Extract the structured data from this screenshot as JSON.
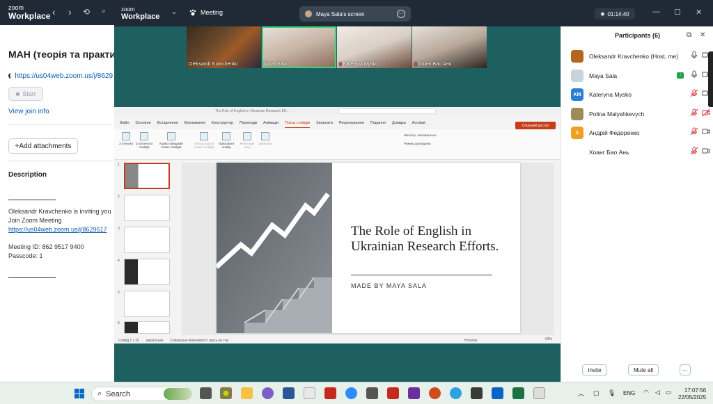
{
  "bg_window": {
    "logo_line1": "zoom",
    "logo_line2": "Workplace",
    "meeting_title": "МАН (теорія та практик",
    "meeting_link": "https://us04web.zoom.us/j/8629",
    "start_label": "Start",
    "view_join_info": "View join info",
    "add_attachments": "+Add attachments",
    "description_title": "Description",
    "description_lines": [
      "Oleksandr Kravchenko is inviting you",
      "Join Zoom Meeting"
    ],
    "description_link": "https://us04web.zoom.us/j/8629517",
    "meeting_id": "Meeting ID: 862 9517 9400",
    "passcode": "Passcode: 1"
  },
  "meeting": {
    "logo_line1": "zoom",
    "logo_line2": "Workplace",
    "meeting_tab": "Meeting",
    "share_label": "Maya Sala's screen",
    "timer": "01:14:40"
  },
  "thumbnails": [
    {
      "name": "Oleksandr Kravchenko"
    },
    {
      "name": "Maya Sala"
    },
    {
      "name": "Kateryna Mysko"
    },
    {
      "name": "Хоанг Бао Ань"
    }
  ],
  "ppt": {
    "doc_title": "The Role of English in Ukrainian Research Eff...",
    "tabs": [
      "Файл",
      "Основне",
      "Вставлення",
      "Малювання",
      "Конструктор",
      "Переходи",
      "Анімація",
      "Показ слайдів",
      "Записати",
      "Рецензування",
      "Подання",
      "Довідка",
      "Acrobat"
    ],
    "active_tab": "Показ слайдів",
    "share_button": "Спільний доступ",
    "ribbon": [
      "З початку",
      "З поточного слайда",
      "Користувацький показ слайдів",
      "Налаштувати показ слайдів",
      "Приховати слайд",
      "Репетиція часу",
      "Записати",
      "Монітор: Автоматично",
      "Режим доповідача"
    ],
    "slide_numbers": [
      "1",
      "2",
      "3",
      "4",
      "5",
      "6"
    ],
    "slide_title": "The Role of English in Ukrainian Research Efforts.",
    "slide_subtitle": "MADE BY MAYA SALA",
    "status_slide": "Слайд 1 з 10",
    "status_lang": "українська",
    "status_access": "Спеціальні можливості: щось не так",
    "status_notes": "Нотатки",
    "zoom_level": "63%"
  },
  "participants": {
    "title": "Participants (6)",
    "list": [
      {
        "name": "Oleksandr Kravchenko (Host, me)",
        "initials": "",
        "color": "#b5651d",
        "sharing": false,
        "mic_muted": false,
        "cam_off": false
      },
      {
        "name": "Maya Sala",
        "initials": "",
        "color": "#c9d3dc",
        "sharing": true,
        "mic_muted": false,
        "cam_off": false
      },
      {
        "name": "Kateryna Mysko",
        "initials": "KM",
        "color": "#2d7dd2",
        "sharing": false,
        "mic_muted": true,
        "cam_off": false
      },
      {
        "name": "Polina Malyshkevych",
        "initials": "",
        "color": "#a08a5a",
        "sharing": false,
        "mic_muted": true,
        "cam_off": true
      },
      {
        "name": "Андрій Федоренко",
        "initials": "A",
        "color": "#f0a020",
        "sharing": false,
        "mic_muted": true,
        "cam_off": false
      },
      {
        "name": "Хоанг Бао Ань",
        "initials": "",
        "color": "#ffffff",
        "sharing": false,
        "mic_muted": true,
        "cam_off": false
      }
    ],
    "invite": "Invite",
    "mute_all": "Mute all",
    "more": "···"
  },
  "taskbar": {
    "search": "Search",
    "lang": "ENG",
    "time": "17:07:56",
    "date": "22/05/2025"
  }
}
